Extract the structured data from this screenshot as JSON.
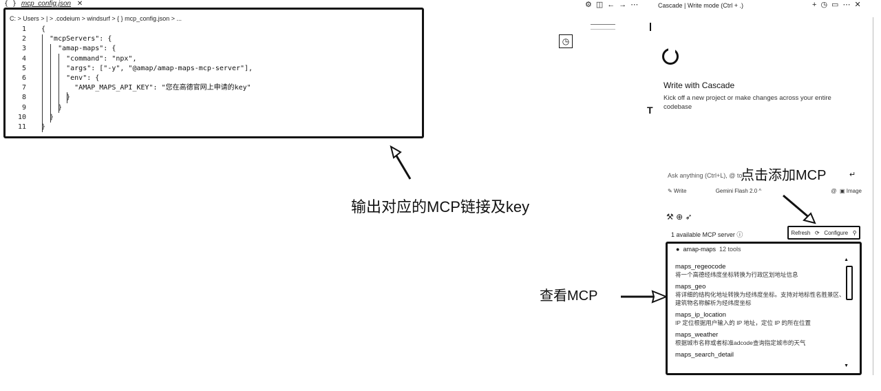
{
  "editor": {
    "tab": {
      "icon": "{ }",
      "label": "mcp_config.json",
      "close": "✕"
    },
    "breadcrumb": "C: > Users > | > .codeium > windsurf > { } mcp_config.json > ...",
    "lines": [
      {
        "n": "1",
        "text": "{"
      },
      {
        "n": "2",
        "text": "  \"mcpServers\": {"
      },
      {
        "n": "3",
        "text": "    \"amap-maps\": {"
      },
      {
        "n": "4",
        "text": "      \"command\": \"npx\","
      },
      {
        "n": "5",
        "text": "      \"args\": [\"-y\", \"@amap/amap-maps-mcp-server\"],"
      },
      {
        "n": "6",
        "text": "      \"env\": {"
      },
      {
        "n": "7",
        "text": "        \"AMAP_MAPS_API_KEY\": \"您在高德官网上申请的key\""
      },
      {
        "n": "8",
        "text": "      }"
      },
      {
        "n": "9",
        "text": "    }"
      },
      {
        "n": "10",
        "text": "  }"
      },
      {
        "n": "11",
        "text": "}"
      }
    ]
  },
  "annotations": {
    "output": "输出对应的MCP链接及key",
    "add": "点击添加MCP",
    "view": "查看MCP"
  },
  "cascade": {
    "title": "Cascade | Write mode (Ctrl + .)",
    "heading": "Write with Cascade",
    "subtitle": "Kick off a new project or make changes across your entire codebase",
    "ask_placeholder": "Ask anything (Ctrl+L), @ to",
    "mode": "Write",
    "model": "Gemini Flash 2.0",
    "image_label": "Image",
    "available": "1 available MCP server",
    "refresh": "Refresh",
    "configure": "Configure",
    "server": {
      "name": "amap-maps",
      "tools_count": "12 tools"
    },
    "tools": [
      {
        "name": "maps_regeocode",
        "desc": "将一个高德经纬度坐标转换为行政区划地址信息"
      },
      {
        "name": "maps_geo",
        "desc": "将详细的结构化地址转换为经纬度坐标。支持对地标性名胜景区、建筑物名称解析为经纬度坐标"
      },
      {
        "name": "maps_ip_location",
        "desc": "IP 定位根据用户输入的 IP 地址，定位 IP 的所在位置"
      },
      {
        "name": "maps_weather",
        "desc": "根据城市名称或者标准adcode查询指定城市的天气"
      },
      {
        "name": "maps_search_detail",
        "desc": ""
      }
    ]
  }
}
